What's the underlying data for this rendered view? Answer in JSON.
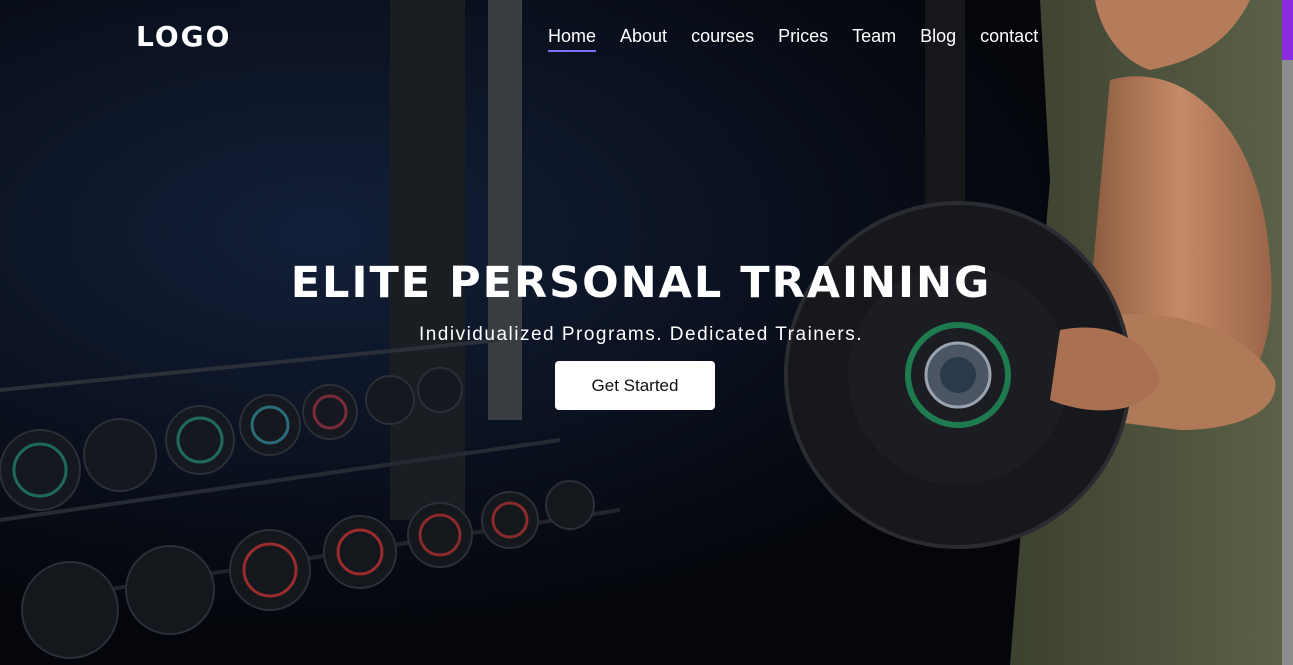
{
  "header": {
    "logo": "LOGO",
    "nav": [
      {
        "label": "Home",
        "active": true
      },
      {
        "label": "About"
      },
      {
        "label": "courses"
      },
      {
        "label": "Prices"
      },
      {
        "label": "Team"
      },
      {
        "label": "Blog"
      },
      {
        "label": "contact"
      }
    ]
  },
  "hero": {
    "title": "ELITE PERSONAL TRAINING",
    "subtitle": "Individualized Programs. Dedicated Trainers.",
    "cta_label": "Get Started"
  },
  "colors": {
    "nav_active_underline": "#7a72ff",
    "scrollbar_thumb": "#8a2be2",
    "button_bg": "#ffffff"
  }
}
